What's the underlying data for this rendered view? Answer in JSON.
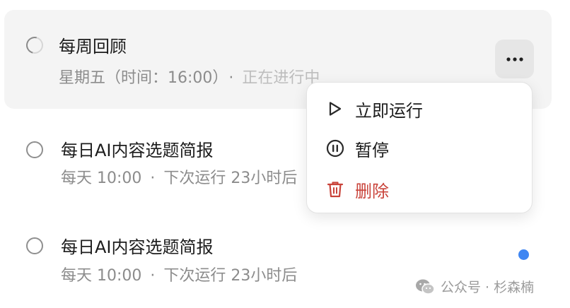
{
  "tasks": [
    {
      "title": "每周回顾",
      "schedule": "星期五（时间：16:00）",
      "separator": "·",
      "status": "正在进行中",
      "state_icon": "spinner-icon"
    },
    {
      "title": "每日AI内容选题简报",
      "schedule": "每天 10:00",
      "separator": "·",
      "next_run": "下次运行 23小时后",
      "state_icon": "circle-icon"
    },
    {
      "title": "每日AI内容选题简报",
      "schedule": "每天 10:00",
      "separator": "·",
      "next_run": "下次运行 23小时后",
      "state_icon": "circle-icon",
      "unread": true
    }
  ],
  "more_button": {
    "icon": "more-horizontal-icon"
  },
  "context_menu": {
    "items": [
      {
        "label": "立即运行",
        "icon": "play-icon"
      },
      {
        "label": "暂停",
        "icon": "pause-circle-icon"
      },
      {
        "label": "删除",
        "icon": "trash-icon",
        "danger": true
      }
    ]
  },
  "watermark": {
    "text": "公众号 · 杉森楠",
    "icon": "wechat-icon"
  },
  "colors": {
    "accent_blue": "#3f86f2",
    "danger": "#c9433a",
    "muted_text": "#8c8c8c",
    "active_row_bg": "#f4f4f4"
  }
}
